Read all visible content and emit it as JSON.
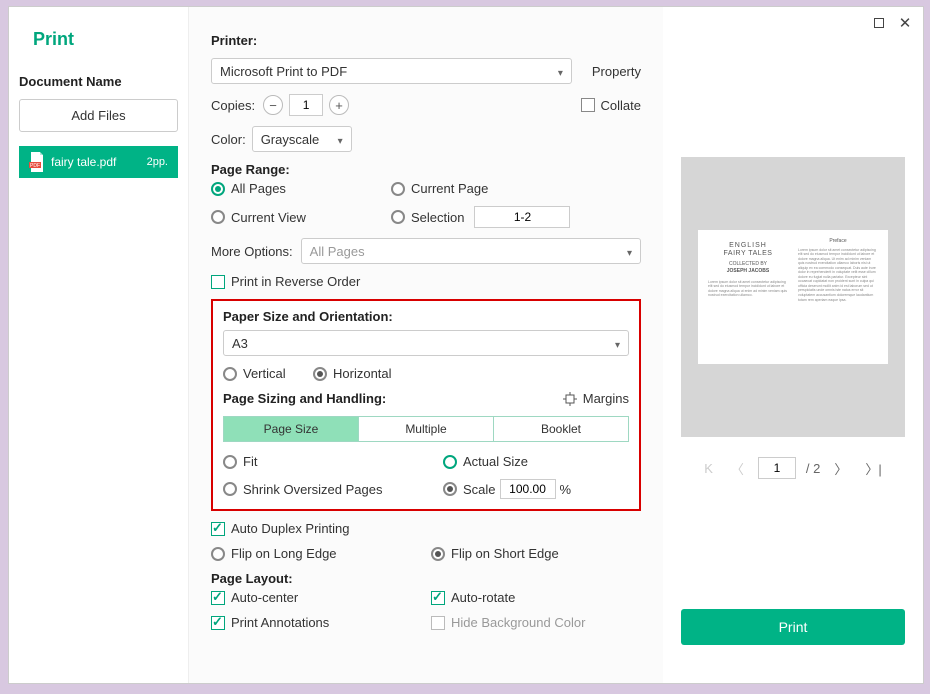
{
  "title": "Print",
  "left": {
    "doc_label": "Document Name",
    "add_files": "Add Files",
    "file_name": "fairy tale.pdf",
    "file_pages": "2pp."
  },
  "center": {
    "printer_label": "Printer:",
    "printer_value": "Microsoft Print to PDF",
    "property": "Property",
    "copies_label": "Copies:",
    "copies_value": "1",
    "collate": "Collate",
    "color_label": "Color:",
    "color_value": "Grayscale",
    "page_range_label": "Page Range:",
    "all_pages": "All Pages",
    "current_page": "Current Page",
    "current_view": "Current View",
    "selection": "Selection",
    "selection_range": "1-2",
    "more_options_label": "More Options:",
    "more_options_value": "All Pages",
    "reverse": "Print in Reverse Order",
    "paper_label": "Paper Size and Orientation:",
    "paper_value": "A3",
    "vertical": "Vertical",
    "horizontal": "Horizontal",
    "sizing_label": "Page Sizing and Handling:",
    "margins": "Margins",
    "tab_page_size": "Page Size",
    "tab_multiple": "Multiple",
    "tab_booklet": "Booklet",
    "fit": "Fit",
    "actual": "Actual Size",
    "shrink": "Shrink Oversized Pages",
    "scale": "Scale",
    "scale_value": "100.00",
    "scale_unit": "%",
    "duplex": "Auto Duplex Printing",
    "flip_long": "Flip on Long Edge",
    "flip_short": "Flip on Short Edge",
    "layout_label": "Page Layout:",
    "auto_center": "Auto-center",
    "auto_rotate": "Auto-rotate",
    "annotations": "Print Annotations",
    "hide_bg": "Hide Background Color"
  },
  "preview": {
    "title1": "ENGLISH",
    "title2": "FAIRY TALES",
    "collected": "COLLECTED BY",
    "author": "JOSEPH JACOBS",
    "right_hdr": "Preface"
  },
  "pager": {
    "page": "1",
    "total": "/ 2"
  },
  "print_btn": "Print"
}
